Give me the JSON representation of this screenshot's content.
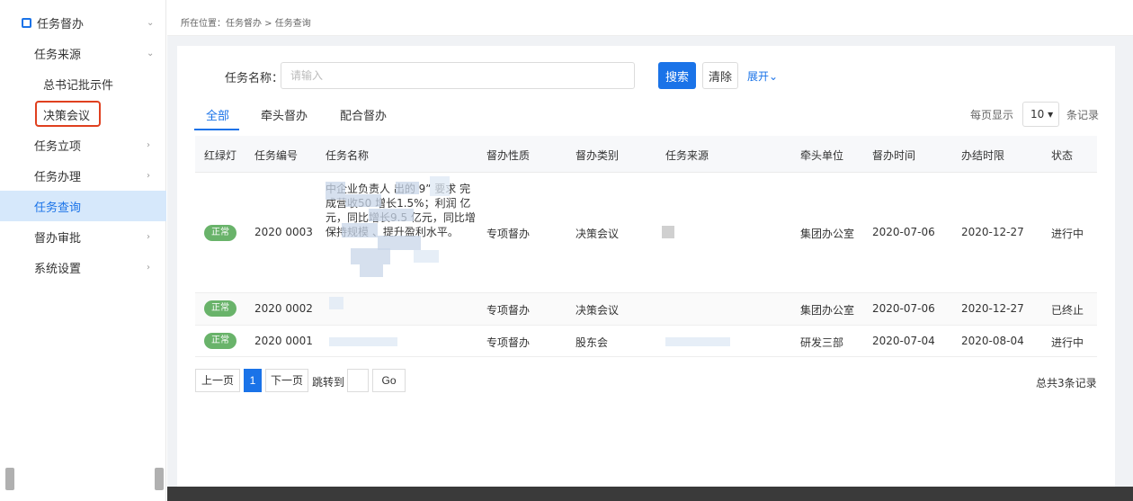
{
  "sidebar": {
    "items": [
      {
        "label": "任务督办",
        "arrow": "⌄"
      },
      {
        "label": "任务来源",
        "arrow": "⌄"
      },
      {
        "label": "总书记批示件"
      },
      {
        "label": "决策会议"
      },
      {
        "label": "任务立项",
        "arrow": "›"
      },
      {
        "label": "任务办理",
        "arrow": "›"
      },
      {
        "label": "任务查询"
      },
      {
        "label": "督办审批",
        "arrow": "›"
      },
      {
        "label": "系统设置",
        "arrow": "›"
      }
    ]
  },
  "breadcrumb": "所在位置：任务督办 > 任务查询",
  "search": {
    "label": "任务名称：",
    "placeholder": "请输入",
    "search_button": "搜索",
    "clear_button": "清除",
    "expand_link": "展开⌄"
  },
  "tabs": [
    "全部",
    "牵头督办",
    "配合督办"
  ],
  "page_size": {
    "prefix": "每页显示",
    "value": "10 ▾",
    "suffix": "条记录"
  },
  "table": {
    "columns": [
      "红绿灯",
      "任务编号",
      "任务名称",
      "督办性质",
      "督办类别",
      "任务来源",
      "牵头单位",
      "督办时间",
      "办结时限",
      "状态"
    ],
    "rows": [
      {
        "light": "正常",
        "id": "2020 0003",
        "name": "中企业负责人 出的 9” 要求 完成营收50 增长1.5%；利润 亿元，同比增长9.5 亿元，同比增 保持规模 、提升盈利水平。",
        "nature": "专项督办",
        "category": "决策会议",
        "unit": "集团办公室",
        "start": "2020-07-06",
        "deadline": "2020-12-27",
        "status": "进行中"
      },
      {
        "light": "正常",
        "id": "2020 0002",
        "nature": "专项督办",
        "category": "决策会议",
        "unit": "集团办公室",
        "start": "2020-07-06",
        "deadline": "2020-12-27",
        "status": "已终止"
      },
      {
        "light": "正常",
        "id": "2020 0001",
        "nature": "专项督办",
        "category": "股东会",
        "unit": "研发三部",
        "start": "2020-07-04",
        "deadline": "2020-08-04",
        "status": "进行中"
      }
    ]
  },
  "pagination": {
    "prev": "上一页",
    "current": "1",
    "next": "下一页",
    "jump_label": "跳转到",
    "go": "Go",
    "total": "总共3条记录"
  }
}
